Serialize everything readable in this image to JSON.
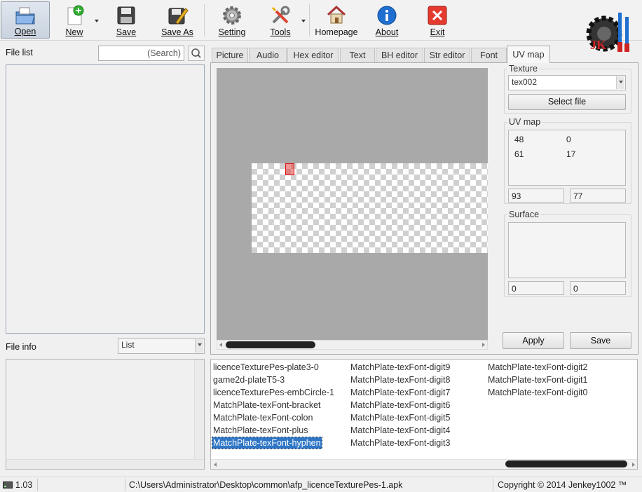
{
  "toolbar": {
    "open": "Open",
    "new": "New",
    "save": "Save",
    "save_as": "Save As",
    "setting": "Setting",
    "tools": "Tools",
    "homepage": "Homepage",
    "about": "About",
    "exit": "Exit",
    "logo_text": "JK"
  },
  "left_panel": {
    "file_list_label": "File list",
    "search_placeholder": "(Search)",
    "file_info_label": "File info",
    "view_mode": "List"
  },
  "tabs": [
    "Picture",
    "Audio",
    "Hex editor",
    "Text",
    "BH editor",
    "Str editor",
    "Font",
    "UV map"
  ],
  "active_tab": "UV map",
  "right_panel": {
    "texture_label": "Texture",
    "texture_value": "tex002",
    "select_file": "Select file",
    "uv_map_label": "UV map",
    "uv_values": [
      "48",
      "0",
      "61",
      "17"
    ],
    "uv_size": [
      "93",
      "77"
    ],
    "surface_label": "Surface",
    "surface_values": [
      "0",
      "0"
    ],
    "apply": "Apply",
    "save": "Save"
  },
  "name_list": {
    "columns": [
      [
        "licenceTexturePes-plate3-0",
        "game2d-plateT5-3",
        "licenceTexturePes-embCircle-1",
        "MatchPlate-texFont-bracket",
        "MatchPlate-texFont-colon",
        "MatchPlate-texFont-plus",
        "MatchPlate-texFont-hyphen"
      ],
      [
        "MatchPlate-texFont-digit9",
        "MatchPlate-texFont-digit8",
        "MatchPlate-texFont-digit7",
        "MatchPlate-texFont-digit6",
        "MatchPlate-texFont-digit5",
        "MatchPlate-texFont-digit4",
        "MatchPlate-texFont-digit3"
      ],
      [
        "MatchPlate-texFont-digit2",
        "MatchPlate-texFont-digit1",
        "MatchPlate-texFont-digit0"
      ]
    ],
    "selected": "MatchPlate-texFont-hyphen"
  },
  "statusbar": {
    "version": "1.03",
    "path": "C:\\Users\\Administrator\\Desktop\\common\\afp_licenceTexturePes-1.apk",
    "copyright": "Copyright © 2014 Jenkey1002 ™"
  },
  "colors": {
    "accent": "#2f76c6",
    "selection_red": "#d11111",
    "canvas_gray": "#a9a9a9"
  }
}
